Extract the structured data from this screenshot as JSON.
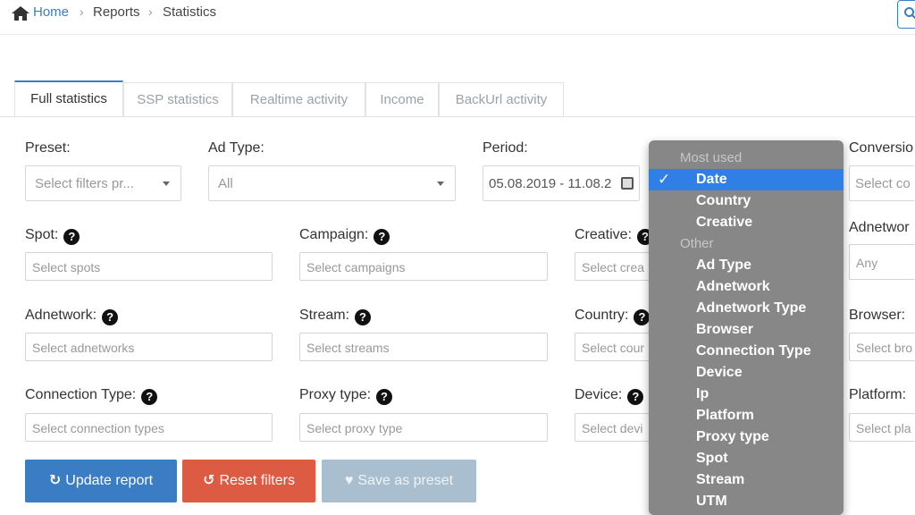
{
  "breadcrumb": {
    "home": "Home",
    "reports": "Reports",
    "current": "Statistics",
    "separator": "›"
  },
  "tabs": [
    "Full statistics",
    "SSP statistics",
    "Realtime activity",
    "Income",
    "BackUrl activity"
  ],
  "form": {
    "preset": {
      "label": "Preset:",
      "value": "Select filters pr..."
    },
    "ad_type": {
      "label": "Ad Type:",
      "value": "All"
    },
    "period": {
      "label": "Period:",
      "value": "05.08.2019 - 11.08.2"
    },
    "conversion": {
      "label": "Conversio",
      "value": "Select co"
    },
    "spot": {
      "label": "Spot:",
      "placeholder": "Select spots"
    },
    "campaign": {
      "label": "Campaign:",
      "placeholder": "Select campaigns"
    },
    "creative": {
      "label": "Creative:",
      "placeholder": "Select crea"
    },
    "adnetwork_right": {
      "label": "Adnetwor",
      "value": "Any"
    },
    "adnetwork": {
      "label": "Adnetwork:",
      "placeholder": "Select adnetworks"
    },
    "stream": {
      "label": "Stream:",
      "placeholder": "Select streams"
    },
    "country": {
      "label": "Country:",
      "placeholder": "Select cour"
    },
    "browser": {
      "label": "Browser:",
      "placeholder": "Select bro"
    },
    "connection_type": {
      "label": "Connection Type:",
      "placeholder": "Select connection types"
    },
    "proxy_type": {
      "label": "Proxy type:",
      "placeholder": "Select proxy type"
    },
    "device": {
      "label": "Device:",
      "placeholder": "Select devi"
    },
    "platform": {
      "label": "Platform:",
      "placeholder": "Select pla"
    },
    "help_glyph": "?"
  },
  "buttons": {
    "update": {
      "icon": "↻",
      "label": "Update report",
      "color": "#3b7dc4"
    },
    "reset": {
      "icon": "↺",
      "label": "Reset filters",
      "color": "#dd5a43"
    },
    "save": {
      "icon": "♥",
      "label": "Save as preset",
      "color": "#a9bfd0"
    }
  },
  "dropdown": {
    "group_most_used": "Most used",
    "most_used": [
      "Date",
      "Country",
      "Creative"
    ],
    "group_other": "Other",
    "other": [
      "Ad Type",
      "Adnetwork",
      "Adnetwork Type",
      "Browser",
      "Connection Type",
      "Device",
      "Ip",
      "Platform",
      "Proxy type",
      "Spot",
      "Stream",
      "UTM"
    ],
    "selected": "Date",
    "check": "✓"
  }
}
